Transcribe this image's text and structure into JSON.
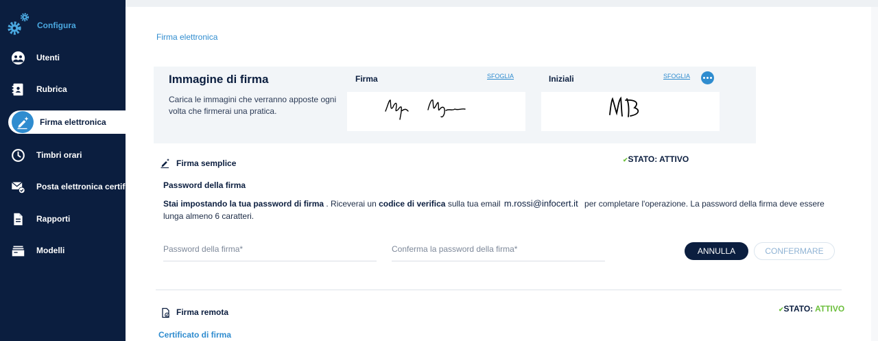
{
  "sidebar": {
    "header_label": "Configura",
    "items": [
      {
        "label": "Utenti",
        "icon": "user-group-icon"
      },
      {
        "label": "Rubrica",
        "icon": "address-book-icon"
      },
      {
        "label": "Firma elettronica",
        "icon": "signature-pen-icon",
        "active": true
      },
      {
        "label": "Timbri orari",
        "icon": "clock-icon"
      },
      {
        "label": "Posta elettronica certificata",
        "icon": "certified-mail-icon"
      },
      {
        "label": "Rapporti",
        "icon": "document-icon"
      },
      {
        "label": "Modelli",
        "icon": "templates-icon"
      }
    ]
  },
  "page": {
    "title": "Firma elettronica"
  },
  "signature_image": {
    "title": "Immagine di firma",
    "description": "Carica le immagini che verranno apposte ogni volta che firmerai una pratica.",
    "firma_label": "Firma",
    "iniziali_label": "Iniziali",
    "browse_label": "SFOGLIA",
    "iniziali_text": "MB"
  },
  "simple_signature": {
    "title": "Firma semplice",
    "status_label": "STATO: ATTIVO",
    "password_heading": "Password della firma",
    "info_bold_1": "Stai impostando la tua password di firma",
    "info_text_1": " . Riceverai un ",
    "info_bold_2": "codice di verifica",
    "info_text_2": " sulla tua email ",
    "email": "m.rossi@infocert.it",
    "info_text_3": " per completare l'operazione. La password della firma deve essere lunga almeno 6 caratteri.",
    "password_placeholder": "Password della firma*",
    "confirm_placeholder": "Conferma la password della firma*",
    "cancel_label": "ANNULLA",
    "confirm_label": "CONFERMARE"
  },
  "remote_signature": {
    "title": "Firma remota",
    "status_prefix": "STATO: ",
    "status_value": "ATTIVO",
    "certificate_link": "Certificato di firma"
  },
  "colors": {
    "sidebar_bg": "#0b1e3f",
    "accent_blue": "#2f8ccf",
    "status_green": "#6cbf3c"
  }
}
